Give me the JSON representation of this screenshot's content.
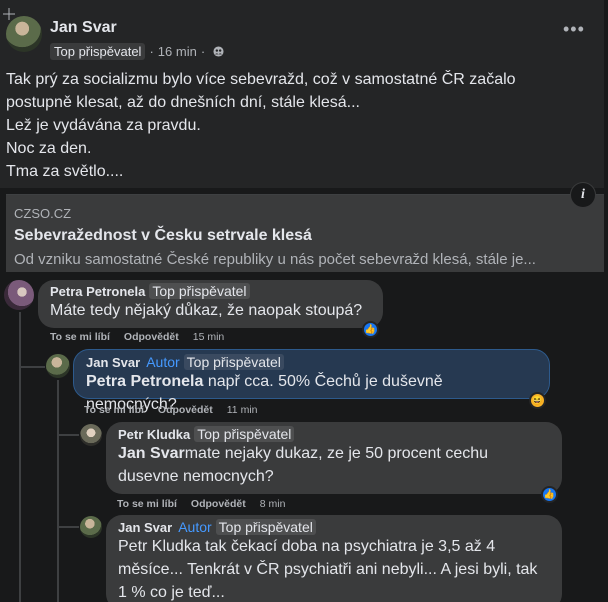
{
  "post": {
    "author": "Jan Svar",
    "badge": "Top přispěvatel",
    "time": "16 min",
    "text_lines": [
      "Tak prý za socializmu bylo více sebevražd, což v samostatné ČR začalo",
      "postupně klesat, až do dnešních dní, stále klesá...",
      "Lež je vydávána za pravdu.",
      "Noc za den.",
      "Tma za světlo...."
    ],
    "more_label": "•••",
    "privacy_icon": "friends-icon"
  },
  "link": {
    "domain": "CZSO.CZ",
    "title": "Sebevražednost v Česku setrvale klesá",
    "description": "Od vzniku samostatné České republiky u nás počet sebevražd klesá, stále je...",
    "info_label": "i"
  },
  "comments": [
    {
      "author": "Petra Petronela",
      "badge": "Top přispěvatel",
      "text": "Máte tedy nějaký důkaz, že naopak stoupá?",
      "like_label": "To se mi líbí",
      "reply_label": "Odpovědět",
      "time": "15 min",
      "reaction": "like"
    },
    {
      "author": "Jan Svar",
      "author_tag": "Autor",
      "badge": "Top přispěvatel",
      "mention": "Petra Petronela",
      "text": " např cca. 50% Čechů je duševně nemocných?",
      "like_label": "To se mi líbí",
      "reply_label": "Odpovědět",
      "time": "11 min",
      "reaction": "haha"
    },
    {
      "author": "Petr Kludka",
      "badge": "Top přispěvatel",
      "mention": "Jan Svar",
      "text_line1": "mate nejaky dukaz, ze je 50 procent cechu",
      "text_line2": "dusevne nemocnych?",
      "like_label": "To se mi líbí",
      "reply_label": "Odpovědět",
      "time": "8 min",
      "reaction": "like"
    },
    {
      "author": "Jan Svar",
      "author_tag": "Autor",
      "badge": "Top přispěvatel",
      "text_line1": "Petr Kludka tak čekací doba na psychiatra je 3,5 až 4",
      "text_line2": "měsíce... Tenkrát v ČR psychiatři ani nebyli... A jesi byli, tak",
      "text_line3": "1 % co je teď..."
    }
  ],
  "colors": {
    "background": "#18191a",
    "card": "#242526",
    "bubble": "#3a3b3c",
    "highlight_bubble": "#263951",
    "accent": "#4599ff"
  }
}
